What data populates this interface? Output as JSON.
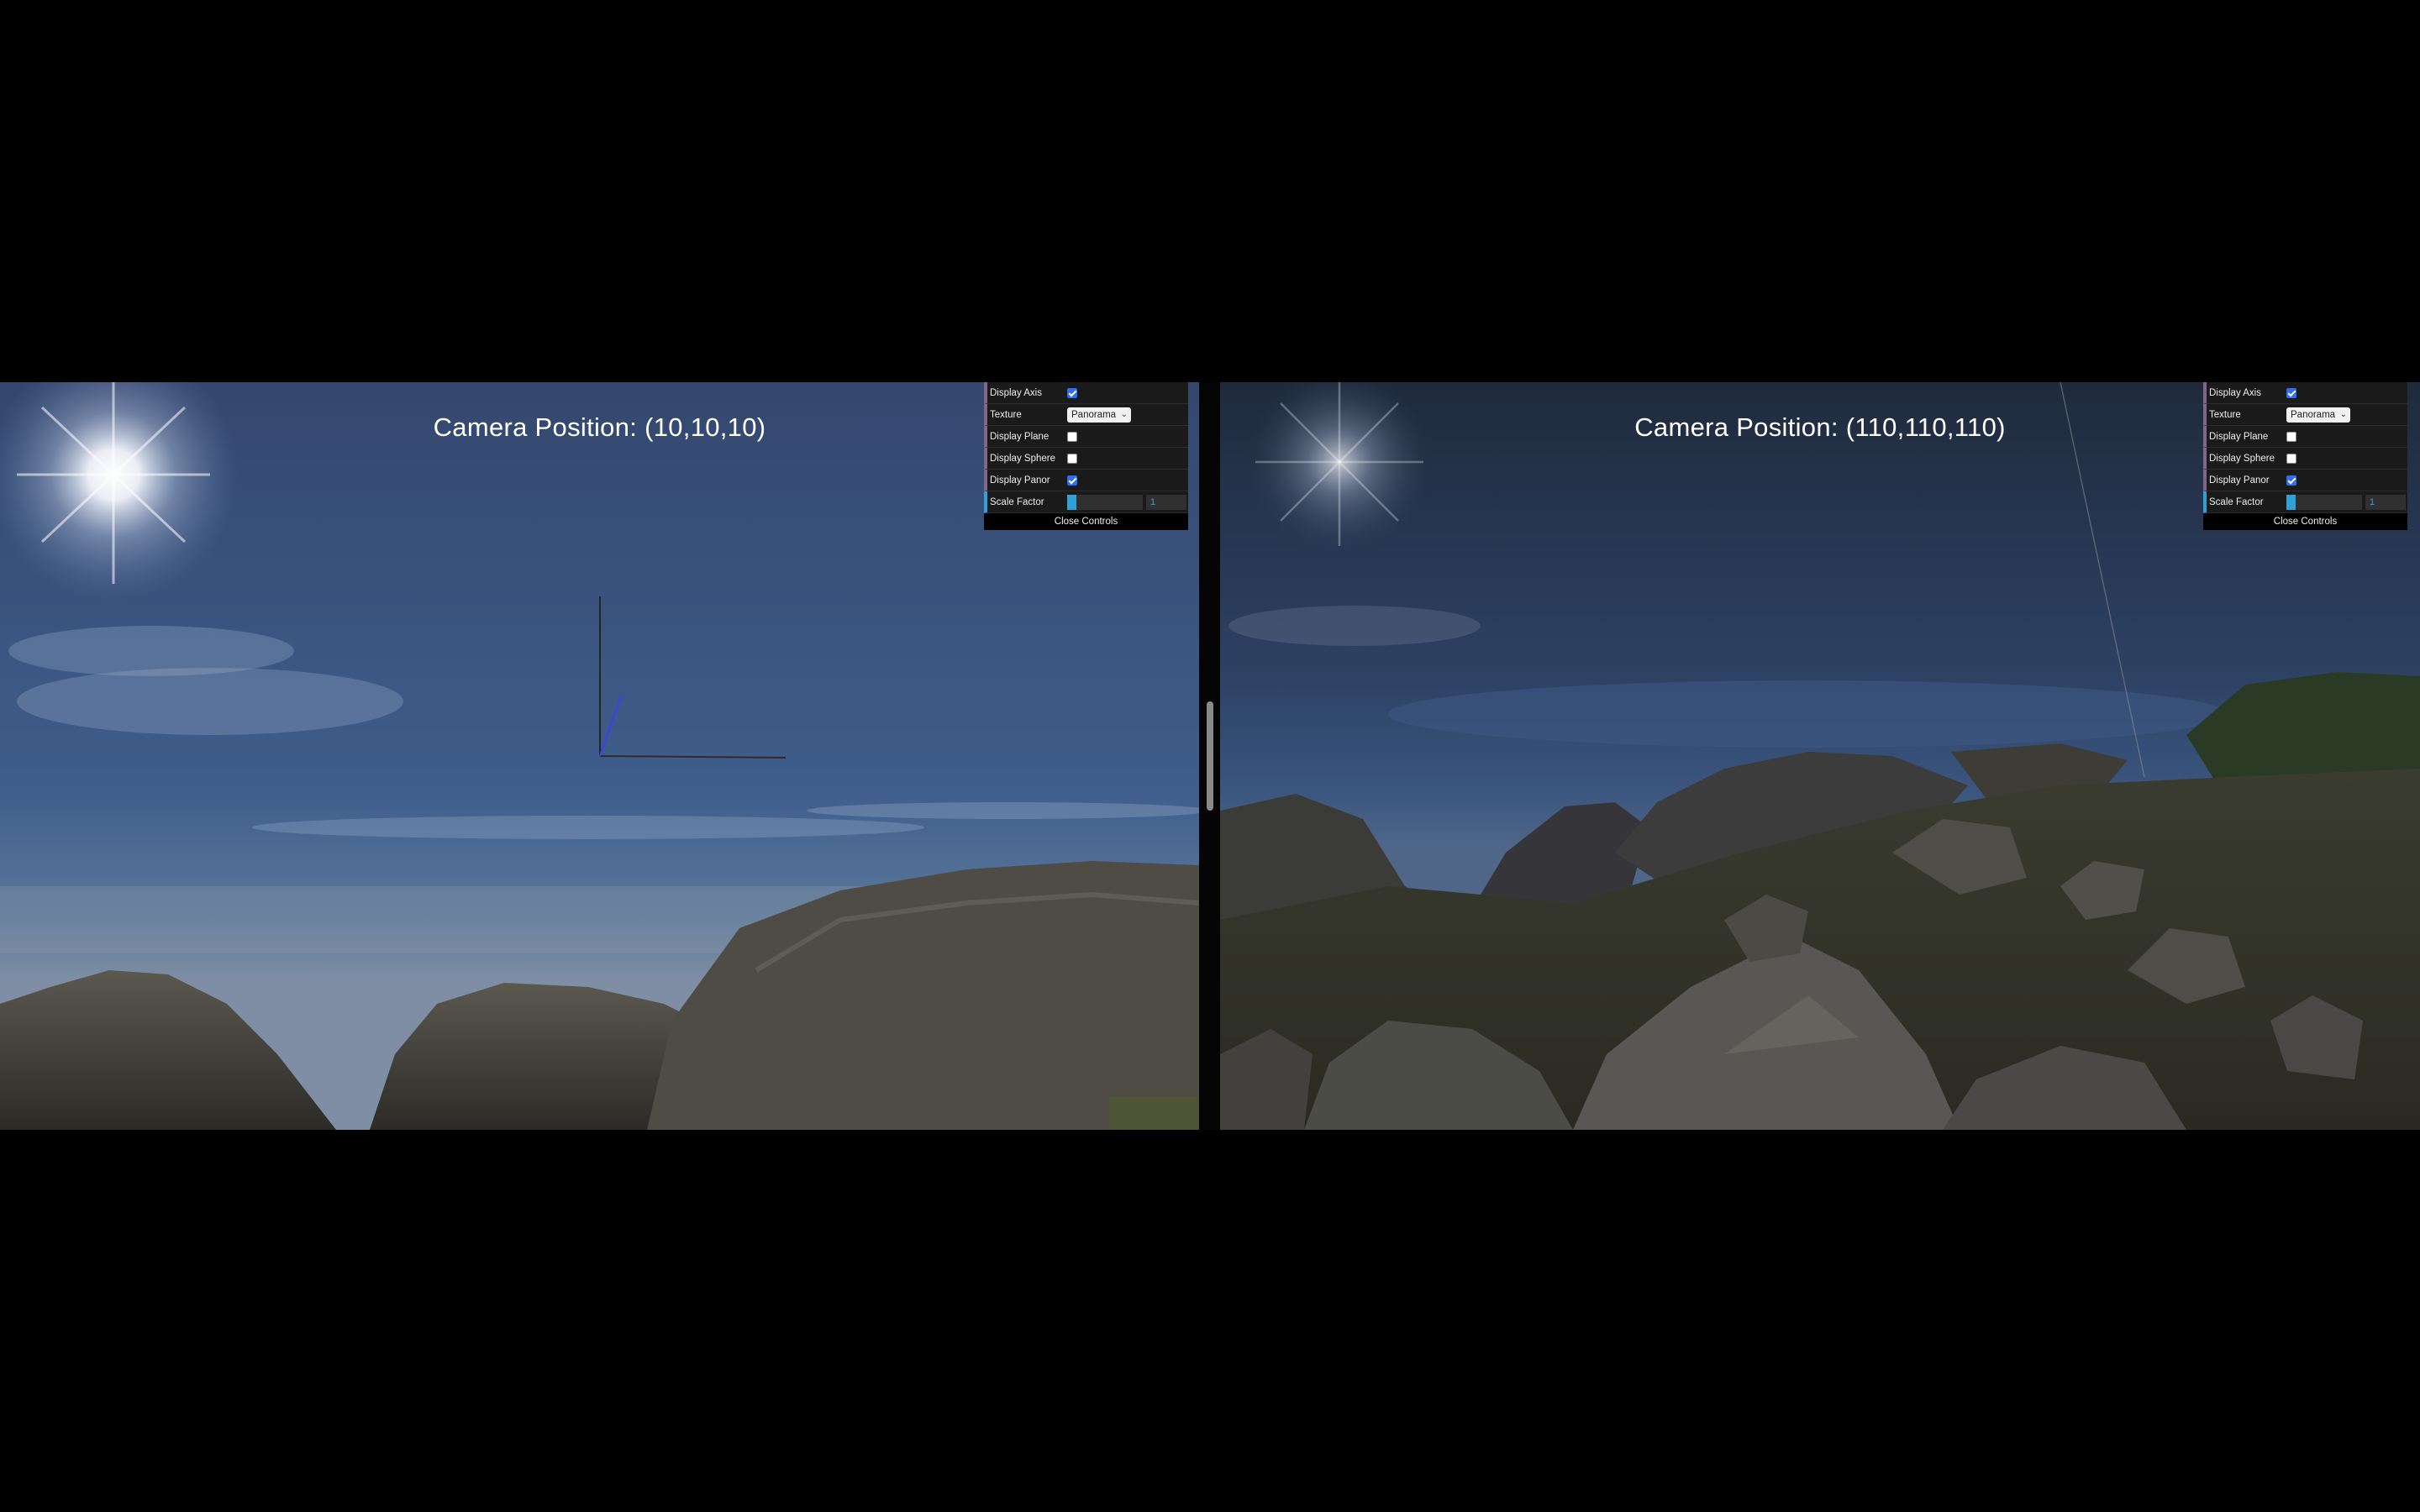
{
  "views": [
    {
      "camera_label": "Camera Position: (10,10,10)",
      "controls": {
        "display_axis": {
          "label": "Display Axis",
          "checked": true
        },
        "texture": {
          "label": "Texture",
          "value": "Panorama"
        },
        "display_plane": {
          "label": "Display Plane",
          "checked": false
        },
        "display_sphere": {
          "label": "Display Sphere",
          "checked": false
        },
        "display_panor": {
          "label": "Display Panor",
          "checked": true
        },
        "scale_factor": {
          "label": "Scale Factor",
          "value": "1",
          "fill": 0.12
        },
        "close": "Close Controls"
      }
    },
    {
      "camera_label": "Camera Position: (110,110,110)",
      "controls": {
        "display_axis": {
          "label": "Display Axis",
          "checked": true
        },
        "texture": {
          "label": "Texture",
          "value": "Panorama"
        },
        "display_plane": {
          "label": "Display Plane",
          "checked": false
        },
        "display_sphere": {
          "label": "Display Sphere",
          "checked": false
        },
        "display_panor": {
          "label": "Display Panor",
          "checked": true
        },
        "scale_factor": {
          "label": "Scale Factor",
          "value": "1",
          "fill": 0.12
        },
        "close": "Close Controls"
      }
    }
  ],
  "icons": {
    "checkbox_on": "checkmark-icon",
    "select_chevron": "chevron-down-icon"
  },
  "colors": {
    "gui_accent": "#2fa1d6",
    "checkbox_on": "#2f6ef0",
    "sky_top": "#33466e",
    "rock": "#3a3a36"
  }
}
